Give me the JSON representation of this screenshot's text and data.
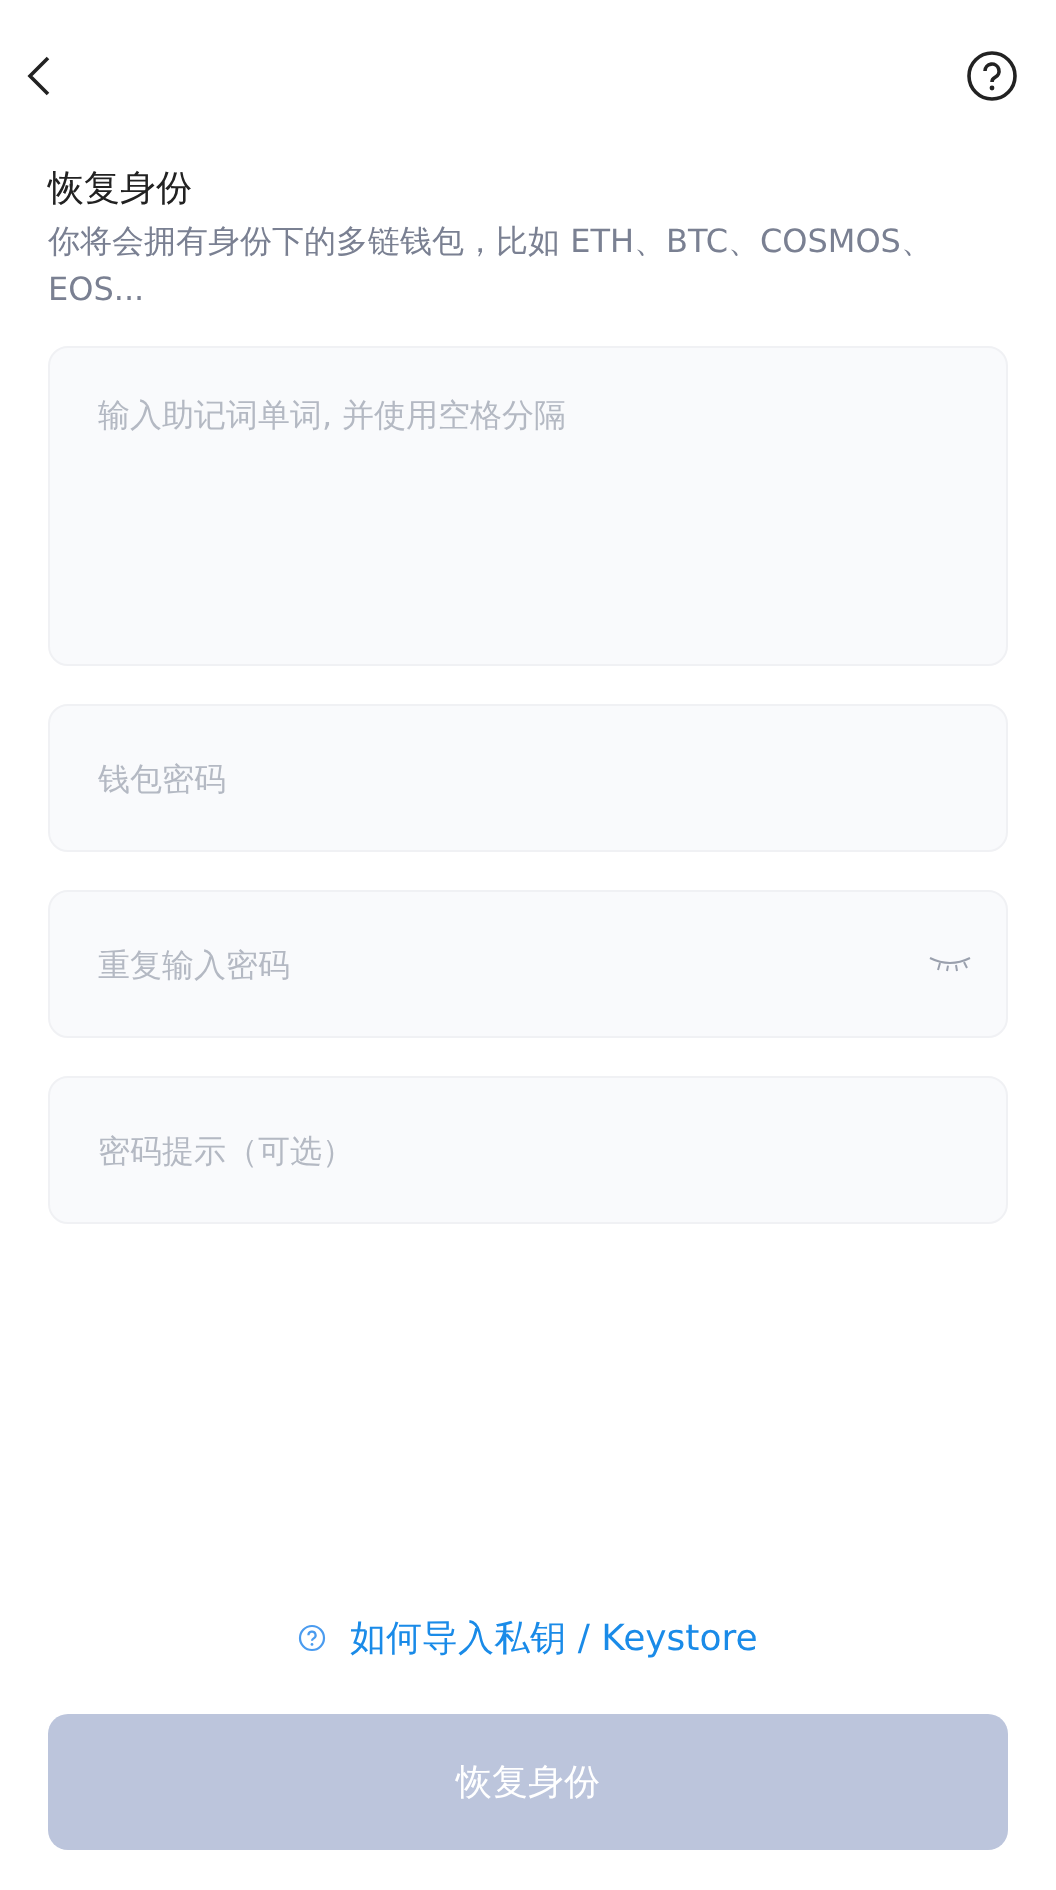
{
  "title": "恢复身份",
  "subtitle": "你将会拥有身份下的多链钱包，比如 ETH、BTC、COSMOS、EOS...",
  "fields": [
    {
      "kind": "textarea",
      "placeholder": "输入助记词单词, 并使用空格分隔"
    },
    {
      "kind": "password",
      "placeholder": "钱包密码"
    },
    {
      "kind": "password",
      "placeholder": "重复输入密码",
      "reveal_toggle": true
    },
    {
      "kind": "text",
      "placeholder": "密码提示（可选）"
    }
  ],
  "help_link": "如何导入私钥 / Keystore",
  "submit": {
    "label": "恢复身份",
    "disabled": true
  }
}
